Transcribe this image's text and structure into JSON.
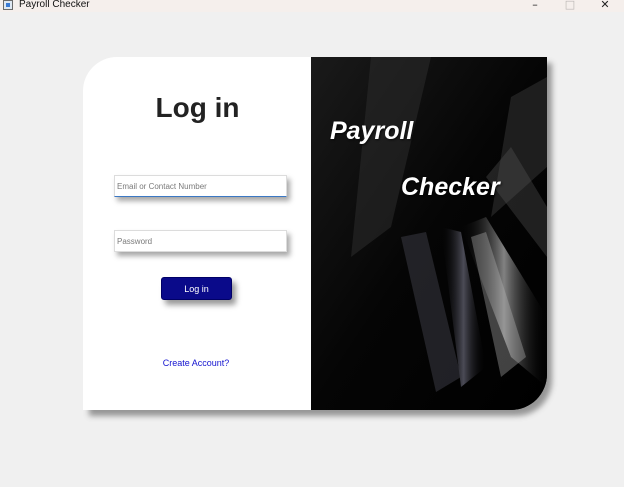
{
  "window": {
    "title": "Payroll Checker",
    "minimize_glyph": "–",
    "maximize_glyph": "□",
    "close_glyph": "✕"
  },
  "login": {
    "heading": "Log in",
    "email_placeholder": "Email or Contact Number",
    "password_placeholder": "Password",
    "button_label": "Log in",
    "create_account_link": "Create Account?"
  },
  "brand": {
    "line1": "Payroll",
    "line2": "Checker"
  },
  "colors": {
    "button_bg": "#0a0a8a",
    "link": "#1515d0",
    "panel_dark": "#050505"
  }
}
